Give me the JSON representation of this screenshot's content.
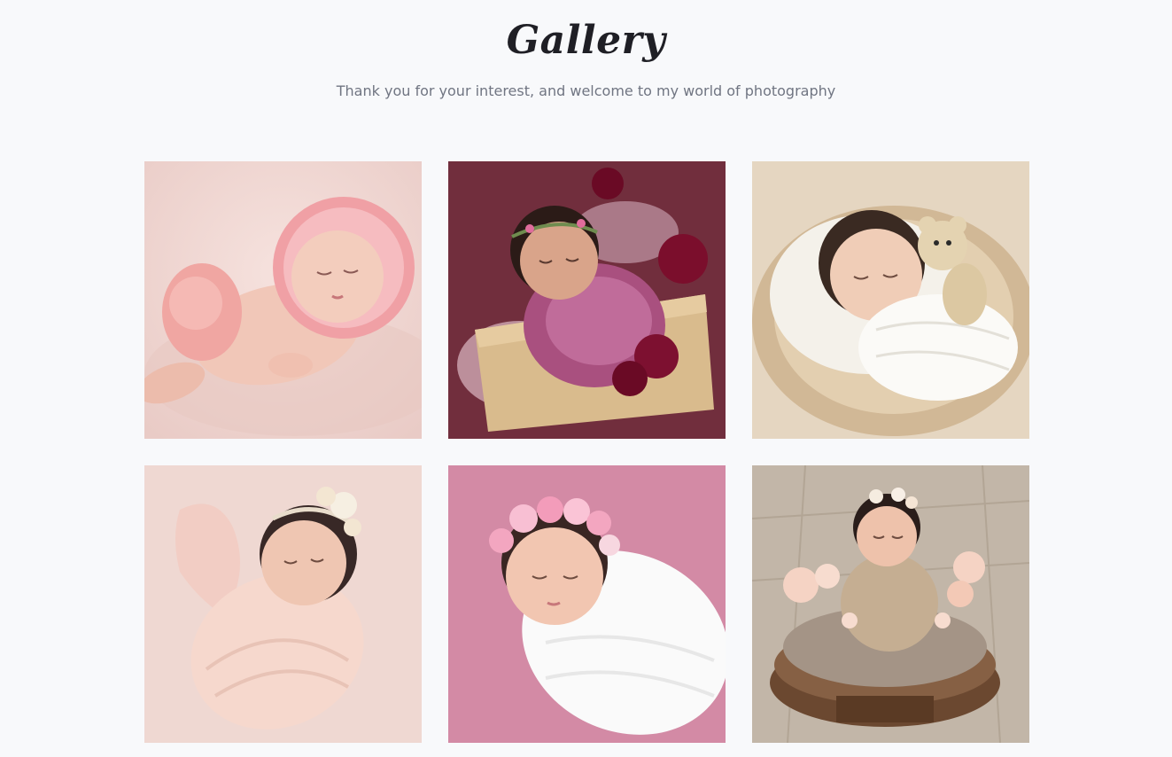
{
  "header": {
    "title": "Gallery",
    "subtitle": "Thank you for your interest, and welcome to my world of photography"
  },
  "gallery": {
    "photos": [
      {
        "subject": "newborn-pink-bonnet",
        "background": "#f0d6d2",
        "accent": "#e8a1a0"
      },
      {
        "subject": "newborn-crate-burgundy",
        "background": "#7a3242",
        "accent": "#a24c86"
      },
      {
        "subject": "newborn-teddy-bear",
        "background": "#e6d6c0",
        "accent": "#f5f2ec"
      },
      {
        "subject": "newborn-peach-wrap",
        "background": "#efd8d2",
        "accent": "#f5d9cf"
      },
      {
        "subject": "newborn-pink-background",
        "background": "#d68aa6",
        "accent": "#fbfbfb"
      },
      {
        "subject": "newborn-wooden-bowl",
        "background": "#bfb2a4",
        "accent": "#c7b49c"
      }
    ]
  }
}
